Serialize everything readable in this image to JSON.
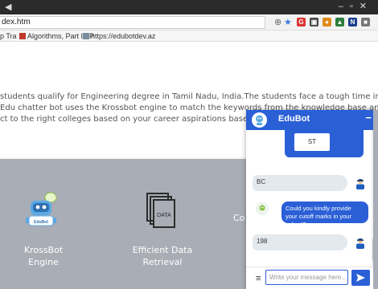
{
  "browser": {
    "url": "dex.htm",
    "bookmarks": [
      {
        "label": "p Tra"
      },
      {
        "label": "Algorithms, Part I - P"
      },
      {
        "label": "https://edubotdev.az"
      }
    ]
  },
  "intro": {
    "lines": [
      "students qualify for Engineering degree in Tamil Nadu, India.The students face a tough time in",
      "Edu chatter bot uses the Krossbot engine to match the keywords from the knowledge base and",
      "ct to the right colleges based on your career aspirations based on your curre"
    ]
  },
  "features": [
    {
      "title_line1": "KrossBot",
      "title_line2": "Engine",
      "badge": "EduBot"
    },
    {
      "title_line1": "Efficient Data Retrieval",
      "title_line2": "",
      "icon_text": "DATA"
    },
    {
      "title_line1": "Co",
      "title_line2": ""
    }
  ],
  "chat": {
    "title": "EduBot",
    "minimize": "−",
    "option_label": "ST",
    "messages": [
      {
        "from": "user",
        "text": "BC"
      },
      {
        "from": "bot",
        "text": "Could you kindly provide your cutoff marks in your school?"
      },
      {
        "from": "user",
        "text": "198"
      }
    ],
    "input_placeholder": "Write your message here...",
    "menu_icon": "≡",
    "colors": {
      "primary": "#2a5fd6",
      "user_bubble": "#e4e9ee",
      "features_band": "#a9adb5"
    }
  }
}
